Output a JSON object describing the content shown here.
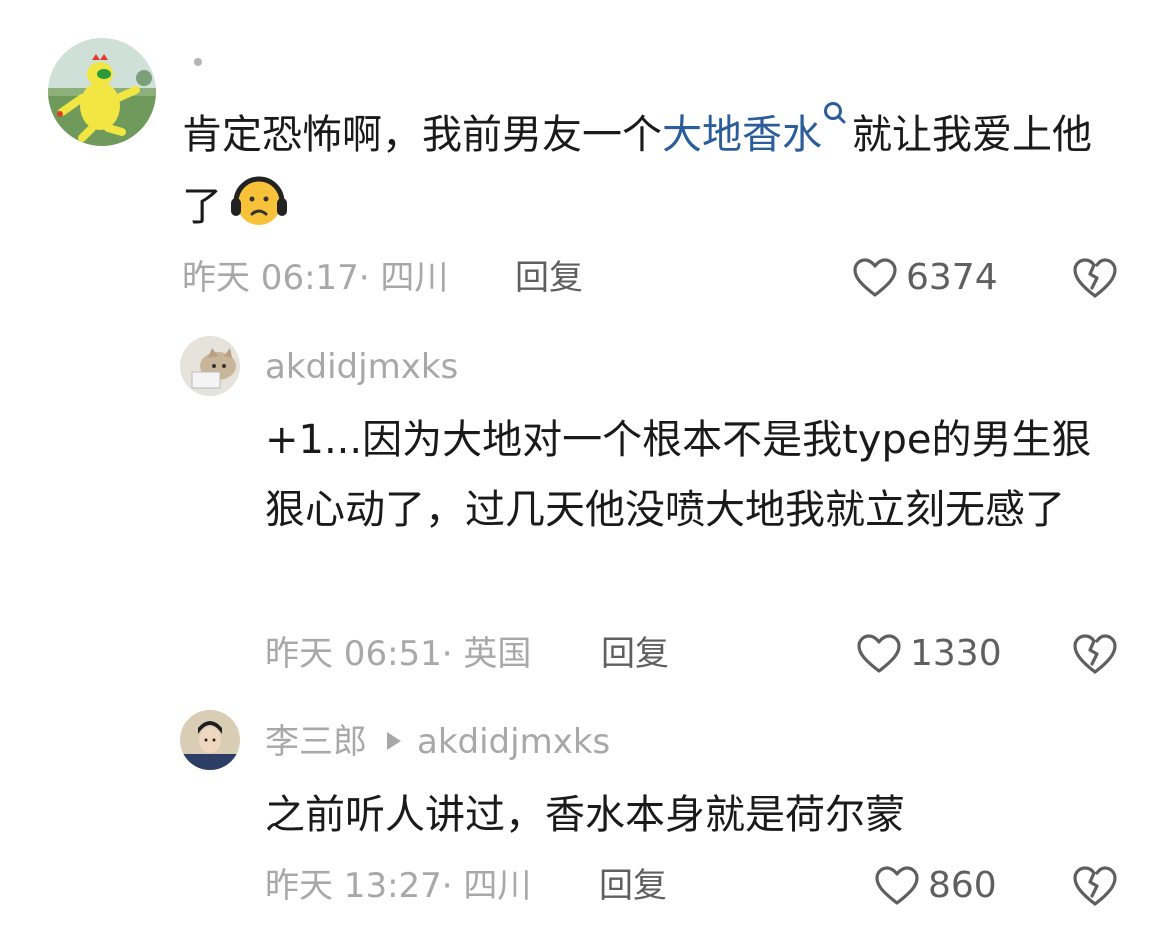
{
  "comments": [
    {
      "username": "·",
      "text_before": "肯定恐怖啊，我前男友一个",
      "link": "大地香水",
      "text_after": "就让我爱上他了",
      "emoji": "headphone-face-emoji",
      "time": "昨天 06:17",
      "location": "四川",
      "reply_label": "回复",
      "likes": "6374"
    },
    {
      "username": "akdidjmxks",
      "text": "+1...因为大地对一个根本不是我type的男生狠狠心动了，过几天他没喷大地我就立刻无感了",
      "time": "昨天 06:51",
      "location": "英国",
      "reply_label": "回复",
      "likes": "1330"
    },
    {
      "username": "李三郎",
      "reply_to": "akdidjmxks",
      "text": "之前听人讲过，香水本身就是荷尔蒙",
      "time": "昨天 13:27",
      "location": "四川",
      "reply_label": "回复",
      "likes": "860"
    }
  ],
  "icons": {
    "like": "heart-outline-icon",
    "dislike": "broken-heart-icon",
    "search": "search-icon",
    "arrow": "reply-arrow-icon"
  },
  "colors": {
    "link": "#2a5d9a",
    "muted": "#a8a8a8",
    "text": "#1a1a1a"
  }
}
